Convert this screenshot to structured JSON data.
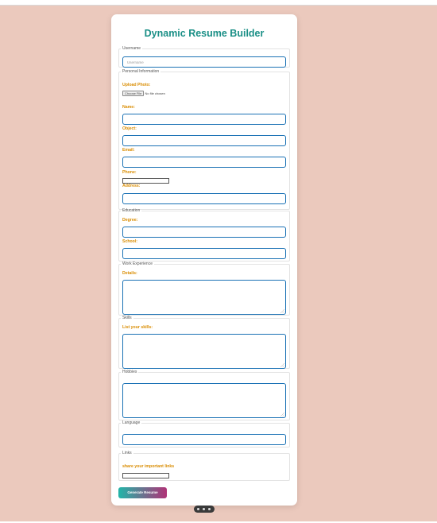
{
  "title": "Dynamic Resume Builder",
  "username": {
    "legend": "Username",
    "placeholder": "Username"
  },
  "personal": {
    "legend": "Personal Information",
    "upload_label": "Upload Photo:",
    "file_button": "Choose File",
    "file_status": "No file chosen",
    "name_label": "Name:",
    "object_label": "Object:",
    "email_label": "Email:",
    "phone_label": "Phone:",
    "address_label": "Address:"
  },
  "education": {
    "legend": "Education",
    "degree_label": "Degree:",
    "school_label": "School:"
  },
  "work": {
    "legend": "Work Experience",
    "details_label": "Details:"
  },
  "skills": {
    "legend": "Skills",
    "list_label": "List your skills:"
  },
  "hobbies": {
    "legend": "Hobbies"
  },
  "language": {
    "legend": "Language"
  },
  "links": {
    "legend": "Links",
    "label": "share your important links"
  },
  "generate_button": "Generate Resume"
}
